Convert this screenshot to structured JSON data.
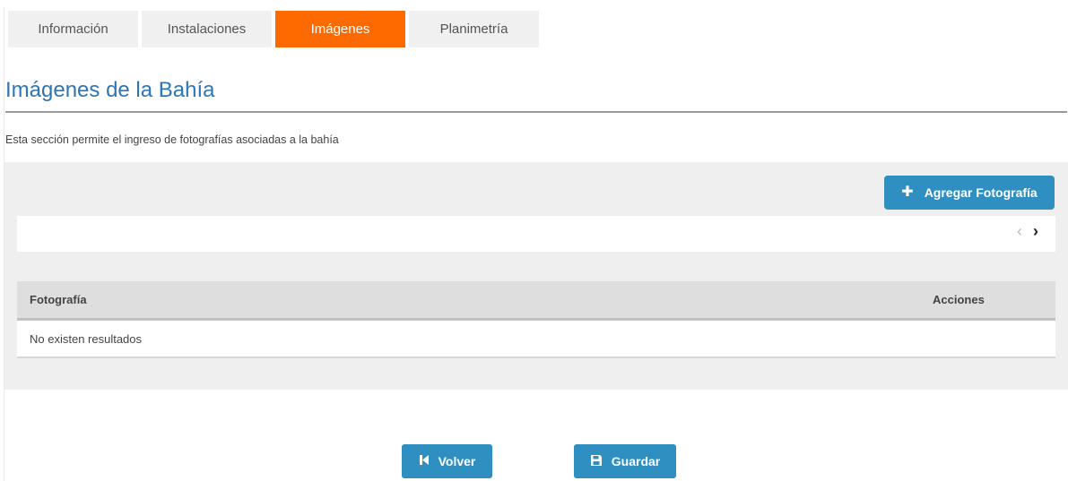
{
  "tabs": [
    {
      "label": "Información",
      "active": false
    },
    {
      "label": "Instalaciones",
      "active": false
    },
    {
      "label": "Imágenes",
      "active": true
    },
    {
      "label": "Planimetría",
      "active": false
    }
  ],
  "section": {
    "title": "Imágenes de la Bahía",
    "description": "Esta sección permite el ingreso de fotografías asociadas a la bahía"
  },
  "toolbar": {
    "add_label": "Agregar Fotografía",
    "add_icon": "plus-icon"
  },
  "pager": {
    "prev_icon": "chevron-left-icon",
    "next_icon": "chevron-right-icon"
  },
  "table": {
    "columns": [
      "Fotografía",
      "Acciones"
    ],
    "empty_message": "No existen resultados"
  },
  "footer": {
    "back_label": "Volver",
    "back_icon": "skip-back-icon",
    "save_label": "Guardar",
    "save_icon": "save-icon"
  },
  "colors": {
    "accent_tab": "#ff6a00",
    "primary_button": "#2e8fc0",
    "title": "#2e75b6"
  }
}
